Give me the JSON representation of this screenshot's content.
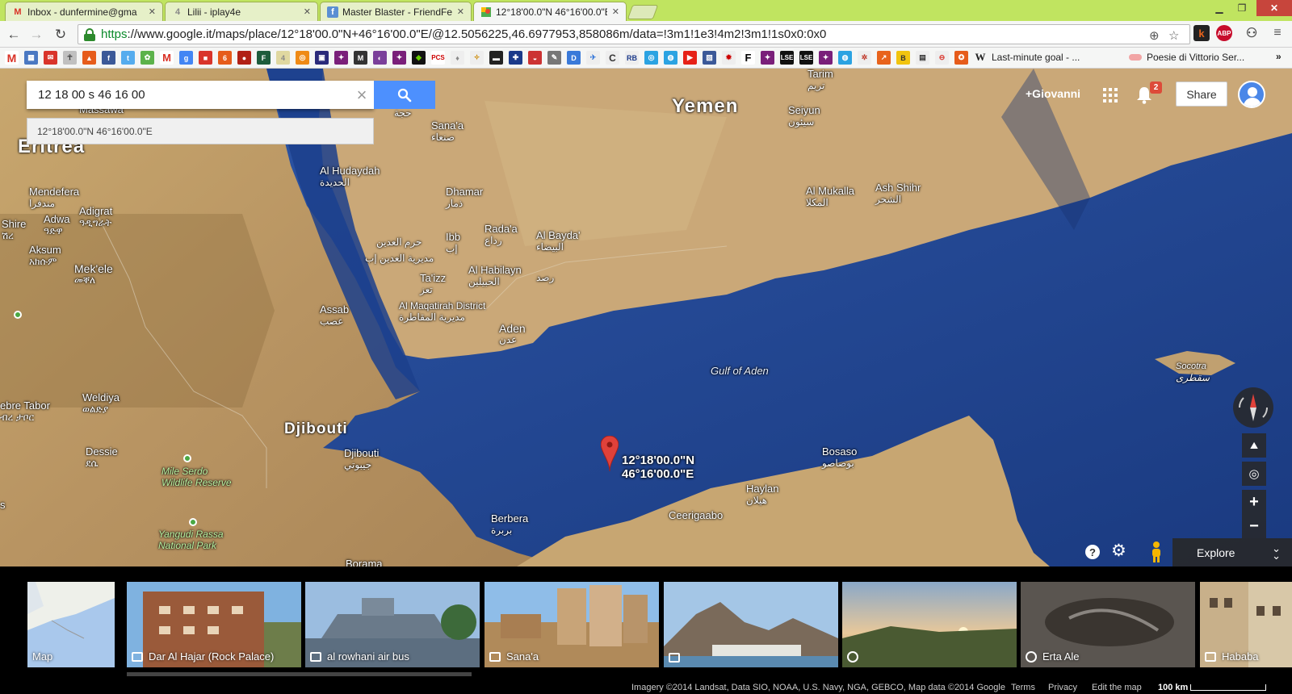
{
  "browser": {
    "tabs": [
      {
        "label": "Inbox - dunfermine@gma",
        "icon": "gmail-icon",
        "active": false
      },
      {
        "label": "Lilii - iplay4e",
        "icon": "iplay4e-icon",
        "active": false
      },
      {
        "label": "Master Blaster - FriendFee",
        "icon": "friendfeed-icon",
        "active": false
      },
      {
        "label": "12°18'00.0\"N 46°16'00.0\"E",
        "icon": "google-maps-icon",
        "active": true
      }
    ],
    "window_controls": {
      "minimize": "▁",
      "restore": "❐",
      "close": "✕"
    },
    "url_https": "https",
    "url_rest": "://www.google.it/maps/place/12°18'00.0\"N+46°16'00.0\"E/@12.5056225,46.6977953,858086m/data=!3m1!1e3!4m2!3m1!1s0x0:0x0",
    "extensions": [
      {
        "name": "keepa-icon",
        "glyph": "k",
        "color": "#e8631c"
      },
      {
        "name": "adblock-plus-icon",
        "glyph": "ABP",
        "color": "#c70d2c"
      }
    ],
    "bookmarks_text": [
      {
        "label": "Last-minute goal - ...",
        "icon": "wikipedia-icon",
        "glyph": "W"
      },
      {
        "label": "Poesie di Vittorio Ser...",
        "icon": "bookmark-item-icon",
        "glyph": "◉"
      }
    ]
  },
  "search": {
    "value": "12 18 00 s 46 16 00",
    "suggestion": "12°18'00.0\"N 46°16'00.0\"E"
  },
  "account": {
    "user": "+Giovanni",
    "notifications": "2",
    "share": "Share"
  },
  "map": {
    "pin_label_line1": "12°18'00.0\"N",
    "pin_label_line2": "46°16'00.0\"E",
    "labels": {
      "yemen": "Yemen",
      "eritrea": "Eritrea",
      "djibouti_country": "Djibouti",
      "gulf": "Gulf of Aden",
      "massawa": "Massawa",
      "tarim": "Tarim",
      "tarim_ar": "تريم",
      "seiyun": "Seiyun",
      "seiyun_ar": "سيئون",
      "hajjah_ar": "حجة",
      "sanaa": "Sana'a",
      "sanaa_ar": "صنعاء",
      "hudaydah": "Al Hudaydah",
      "hudaydah_ar": "الحديدة",
      "dhamar": "Dhamar",
      "dhamar_ar": "ذمار",
      "mendefera": "Mendefera",
      "mendefera_ar": "مندفرا",
      "adigrat": "Adigrat",
      "adigrat_am": "ዓዲግራት",
      "adwa": "Adwa",
      "adwa_am": "ዓድዋ",
      "shire": "Shire",
      "shire_am": "ሽረ",
      "aksum": "Aksum",
      "aksum_am": "አክሱም",
      "ibb": "Ibb",
      "ibb_ar": "إب",
      "radaa": "Rada'a",
      "radaa_ar": "رداع",
      "albayda": "Al Bayda'",
      "albayda_ar": "البيضاء",
      "haram_ar": "حرم العدين",
      "mudiriyat_ar": "مديرية العدين إب",
      "rahd_ar": "رصد",
      "mukalla": "Al Mukalla",
      "mukalla_ar": "المكلا",
      "ashshihr": "Ash Shihr",
      "ashshihr_ar": "الشحر",
      "mekele": "Mek'ele",
      "mekele_am": "መቐለ",
      "taizz": "Ta'izz",
      "taizz_ar": "تعز",
      "habilayn": "Al Habilayn",
      "habilayn_ar": "الحبيلين",
      "maqatirah": "Al Maqatirah District",
      "maqatirah_ar": "مديرية المقاطرة",
      "assab": "Assab",
      "assab_ar": "عصب",
      "aden": "Aden",
      "aden_ar": "عدن",
      "socotra": "Socotra",
      "socotra_ar": "سقطرى",
      "debretabor": "ebre Tabor",
      "debretabor_am": "ብረ ታቦር",
      "weldiya": "Weldiya",
      "weldiya_am": "ወልድያ",
      "djibouti_city": "Djibouti",
      "djibouti_ar": "جيبوتي",
      "bosaso": "Bosaso",
      "bosaso_ar": "بوصاصو",
      "dessie": "Dessie",
      "dessie_am": "ደሴ",
      "mileserdo1": "Mile Serdo",
      "mileserdo2": "Wildlife Reserve",
      "haylan": "Haylan",
      "haylan_ar": "هيلان",
      "berbera": "Berbera",
      "berbera_ar": "بربرة",
      "ceerigaabo": "Ceerigaabo",
      "yangudi1": "Yangudi Rassa",
      "yangudi2": "National Park",
      "borama": "Borama",
      "s_left": "s"
    },
    "explore": "Explore"
  },
  "filmstrip": [
    {
      "caption": "Map",
      "kind": "map"
    },
    {
      "caption": "Dar Al Hajar (Rock Palace)",
      "kind": "panorama"
    },
    {
      "caption": "al rowhani air bus",
      "kind": "photo"
    },
    {
      "caption": "Sana'a",
      "kind": "photo"
    },
    {
      "caption": "",
      "kind": "panorama"
    },
    {
      "caption": "",
      "kind": "360"
    },
    {
      "caption": "Erta Ale",
      "kind": "photosphere"
    },
    {
      "caption": "Hababa",
      "kind": "panorama"
    }
  ],
  "footer": {
    "imagery": "Imagery ©2014 Landsat, Data SIO, NOAA, U.S. Navy, NGA, GEBCO, Map data ©2014 Google",
    "terms": "Terms",
    "privacy": "Privacy",
    "edit": "Edit the map",
    "scale": "100 km"
  }
}
